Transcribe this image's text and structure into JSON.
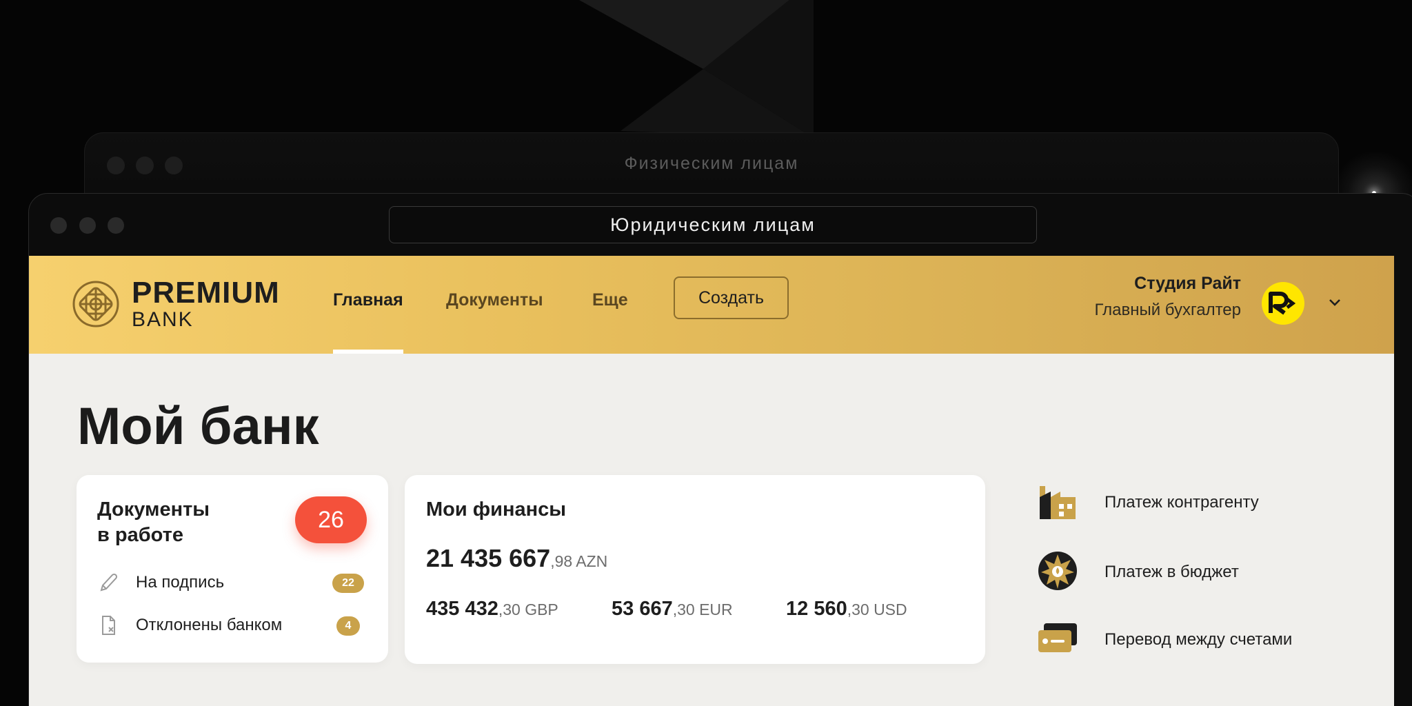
{
  "back_window": {
    "title": "Физическим лицам"
  },
  "front_window": {
    "url_title": "Юридическим лицам"
  },
  "header": {
    "logo": {
      "premium": "PREMIUM",
      "bank": "BANK"
    },
    "nav": [
      {
        "label": "Главная",
        "active": true
      },
      {
        "label": "Документы",
        "active": false
      },
      {
        "label": "Еще",
        "active": false
      }
    ],
    "create_label": "Создать",
    "user": {
      "name": "Студия Райт",
      "role": "Главный бухгалтер",
      "avatar_icon": "rait-logo-icon"
    }
  },
  "page": {
    "title": "Мой банк"
  },
  "docs_card": {
    "title_line1": "Документы",
    "title_line2": "в работе",
    "total": "26",
    "rows": [
      {
        "label": "На подпись",
        "count": "22",
        "icon": "pen-icon"
      },
      {
        "label": "Отклонены банком",
        "count": "4",
        "icon": "rejected-doc-icon"
      }
    ]
  },
  "finances_card": {
    "title": "Мои финансы",
    "main": {
      "int": "21 435 667",
      "frac": ",98 AZN"
    },
    "currencies": [
      {
        "int": "435 432",
        "frac": ",30 GBP"
      },
      {
        "int": "53 667",
        "frac": ",30 EUR"
      },
      {
        "int": "12 560",
        "frac": ",30 USD"
      }
    ]
  },
  "quick_actions": [
    {
      "label": "Платеж контрагенту",
      "icon": "factory-icon"
    },
    {
      "label": "Платеж в бюджет",
      "icon": "emblem-icon"
    },
    {
      "label": "Перевод между счетами",
      "icon": "cards-icon"
    }
  ],
  "colors": {
    "accent_gold": "#c9a24a",
    "badge_red": "#f4513b",
    "avatar_yellow": "#ffe600"
  }
}
